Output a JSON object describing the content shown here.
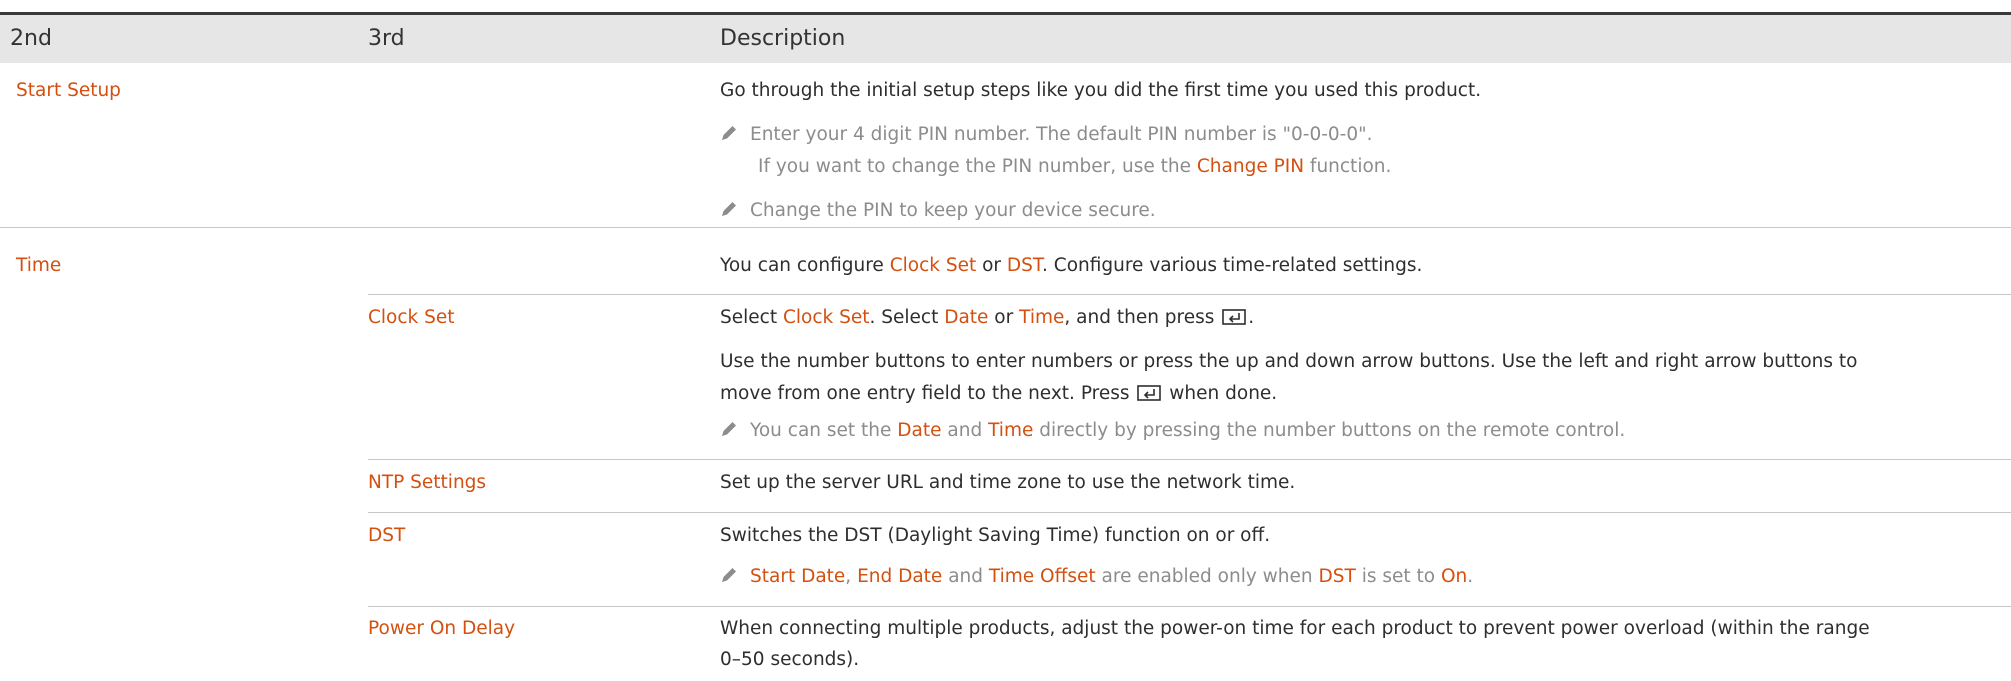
{
  "header": {
    "col2": "2nd",
    "col3": "3rd",
    "col_desc": "Description"
  },
  "start_setup": {
    "label": "Start Setup",
    "desc": "Go through the initial setup steps like you did the first time you used this product.",
    "note1_line1": "Enter your 4 digit PIN number. The default PIN number is \"0-0-0-0\".",
    "note1_line2_pre": "If you want to change the PIN number, use the ",
    "note1_line2_hl": "Change PIN",
    "note1_line2_post": " function.",
    "note2": "Change the PIN to keep your device secure."
  },
  "time": {
    "label": "Time",
    "desc_pre": "You can configure ",
    "desc_hl1": "Clock Set",
    "desc_mid": " or ",
    "desc_hl2": "DST",
    "desc_post": ". Configure various time-related settings."
  },
  "clock_set": {
    "label": "Clock Set",
    "line1_a": "Select ",
    "line1_b": "Clock Set",
    "line1_c": ". Select ",
    "line1_d": "Date",
    "line1_e": " or ",
    "line1_f": "Time",
    "line1_g": ", and then press ",
    "line1_h": ".",
    "para_line1": "Use the number buttons to enter numbers or press the up and down arrow buttons. Use the left and right arrow buttons to",
    "para_line2_pre": "move from one entry field to the next. Press ",
    "para_line2_post": " when done.",
    "note_a": "You can set the ",
    "note_b": "Date",
    "note_c": " and ",
    "note_d": "Time",
    "note_e": " directly by pressing the number buttons on the remote control."
  },
  "ntp": {
    "label": "NTP Settings",
    "desc": "Set up the server URL and time zone to use the network time."
  },
  "dst": {
    "label": "DST",
    "desc": "Switches the DST (Daylight Saving Time) function on or off.",
    "note_a": "Start Date",
    "note_b": ", ",
    "note_c": "End Date",
    "note_d": " and ",
    "note_e": "Time Offset",
    "note_f": " are enabled only when ",
    "note_g": "DST",
    "note_h": " is set to ",
    "note_i": "On",
    "note_j": "."
  },
  "power_on_delay": {
    "label": "Power On Delay",
    "line1": "When connecting multiple products, adjust the power-on time for each product to prevent power overload (within the range",
    "line2": "0–50 seconds)."
  },
  "icons": {
    "note": "pencil-icon",
    "enter": "enter-key-icon"
  },
  "colors": {
    "highlight": "#d4500f",
    "header_bg": "#e6e6e6",
    "note_text": "#8c8c8c",
    "rule": "#c7c7c7"
  }
}
